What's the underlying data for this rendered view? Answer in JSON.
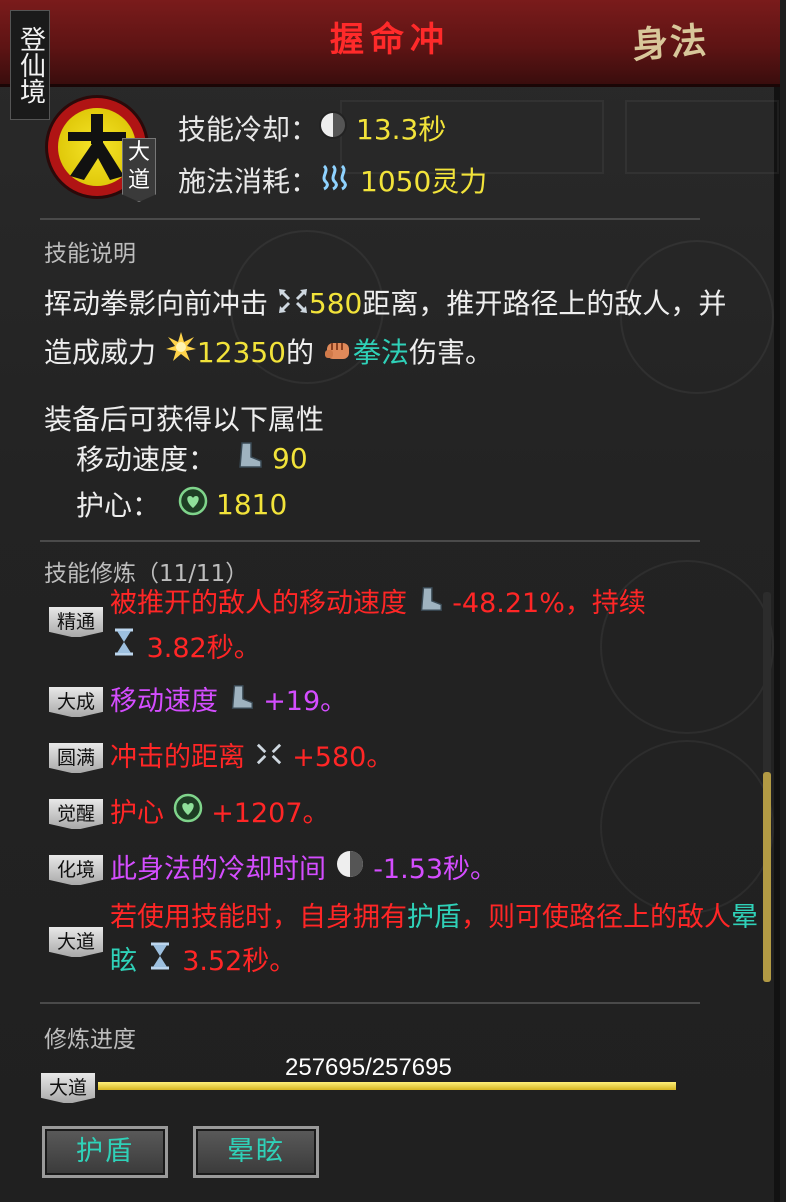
{
  "header": {
    "realm": "登仙境",
    "title": "握命冲",
    "type": "身法"
  },
  "skill": {
    "grade": "大道",
    "cooldown_label": "技能冷却：",
    "cooldown_value": "13.3秒",
    "cost_label": "施法消耗：",
    "cost_value": "1050灵力"
  },
  "description": {
    "section_title": "技能说明",
    "p1": "挥动拳影向前冲击",
    "distance": "580",
    "p2": "距离，推开路径上的敌人，并造成威力",
    "power": "12350",
    "p3": "的",
    "damage_type": "拳法",
    "p4": "伤害。"
  },
  "attributes": {
    "heading": "装备后可获得以下属性",
    "items": [
      {
        "label": "移动速度：",
        "value": "90",
        "icon": "boot-icon"
      },
      {
        "label": "护心：",
        "value": "1810",
        "icon": "heart-shield-icon"
      }
    ]
  },
  "training": {
    "section_title": "技能修炼（11/11）",
    "levels": [
      {
        "tag": "精通",
        "color": "#ff2626",
        "text_a": "被推开的敌人的移动速度",
        "value_a": "-48.21%，持续",
        "value_b": "3.82秒。"
      },
      {
        "tag": "大成",
        "color": "#d44dff",
        "text_a": "移动速度",
        "value_a": "+19。"
      },
      {
        "tag": "圆满",
        "color": "#ff2626",
        "text_a": "冲击的距离",
        "value_a": "+580。"
      },
      {
        "tag": "觉醒",
        "color": "#ff2626",
        "text_a": "护心",
        "value_a": "+1207。"
      },
      {
        "tag": "化境",
        "color": "#d44dff",
        "text_a": "此身法的冷却时间",
        "value_a": "-1.53秒。"
      },
      {
        "tag": "大道",
        "color": "#ff2626",
        "text_a": "若使用技能时，自身拥有",
        "kw1": "护盾",
        "text_b": "，则可使路径上的敌人",
        "kw2": "晕眩",
        "value_a": "3.52秒。"
      }
    ]
  },
  "progress": {
    "section_title": "修炼进度",
    "grade": "大道",
    "text": "257695/257695",
    "fraction": 1.0
  },
  "buttons": {
    "shield": "护盾",
    "stun": "晕眩"
  },
  "colors": {
    "title_red": "#ff2a2a",
    "value_yellow": "#f2e33a",
    "keyword_teal": "#2fd1b8",
    "effect_red": "#ff2626",
    "effect_purple": "#d44dff"
  }
}
